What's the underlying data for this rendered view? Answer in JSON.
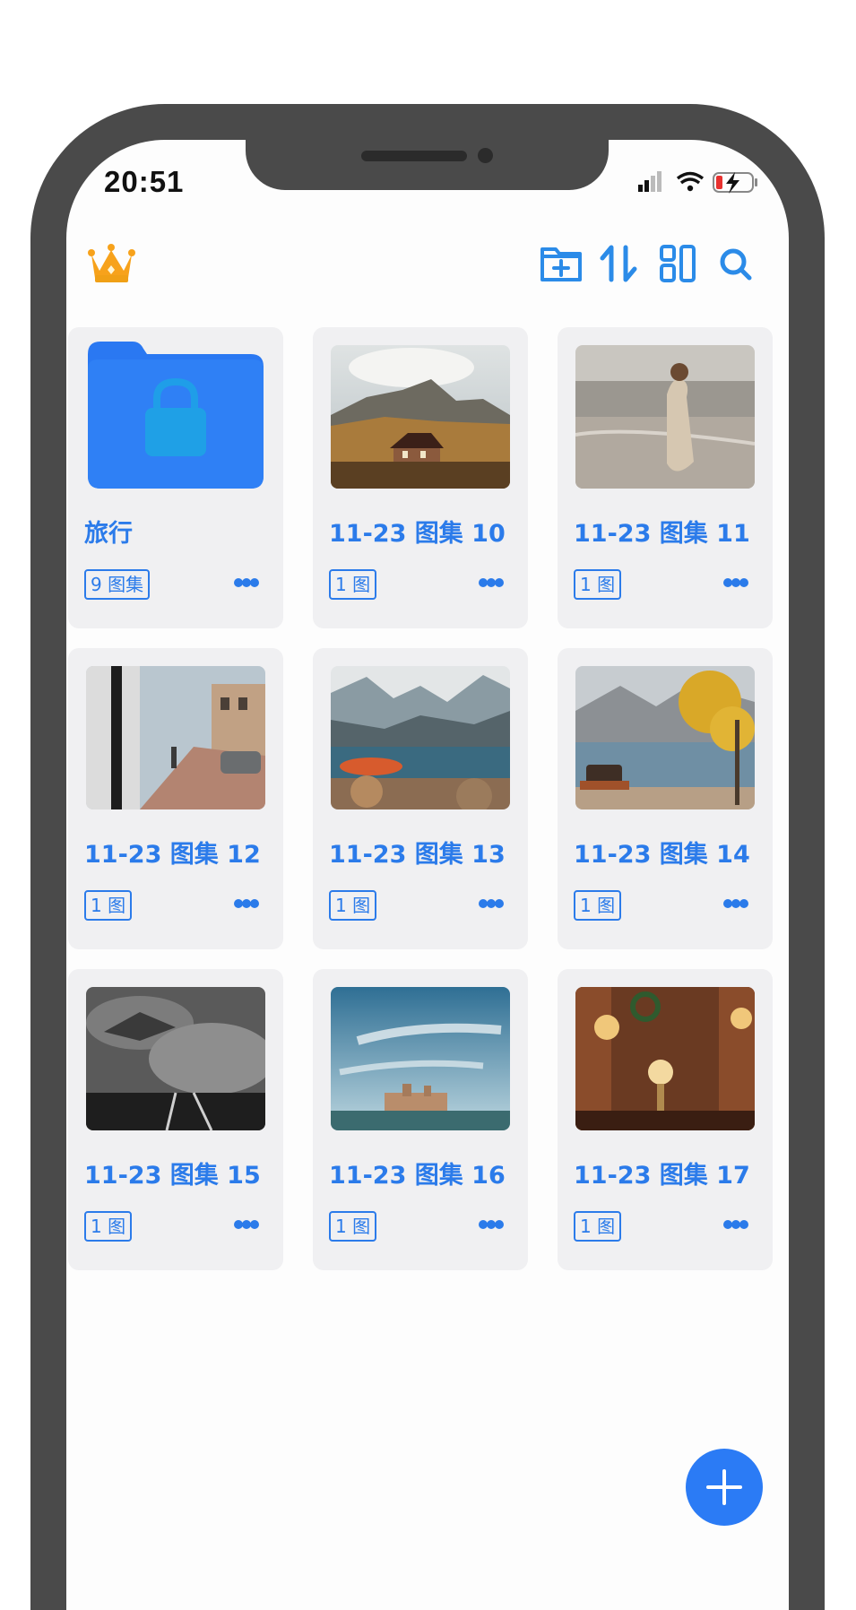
{
  "status_bar": {
    "time": "20:51"
  },
  "toolbar": {
    "crown_icon": "crown-icon",
    "actions": [
      "new-folder-icon",
      "sort-icon",
      "layout-icon",
      "search-icon"
    ],
    "accent_color": "#2b7bea"
  },
  "albums": [
    {
      "title": "旅行",
      "badge": "9 图集",
      "type": "locked-folder"
    },
    {
      "title": "11-23 图集 10",
      "badge": "1 图"
    },
    {
      "title": "11-23 图集 11",
      "badge": "1 图"
    },
    {
      "title": "11-23 图集 12",
      "badge": "1 图"
    },
    {
      "title": "11-23 图集 13",
      "badge": "1 图"
    },
    {
      "title": "11-23 图集 14",
      "badge": "1 图"
    },
    {
      "title": "11-23 图集 15",
      "badge": "1 图"
    },
    {
      "title": "11-23 图集 16",
      "badge": "1 图"
    },
    {
      "title": "11-23 图集 17",
      "badge": "1 图"
    }
  ],
  "fab": {
    "icon": "plus-icon"
  }
}
